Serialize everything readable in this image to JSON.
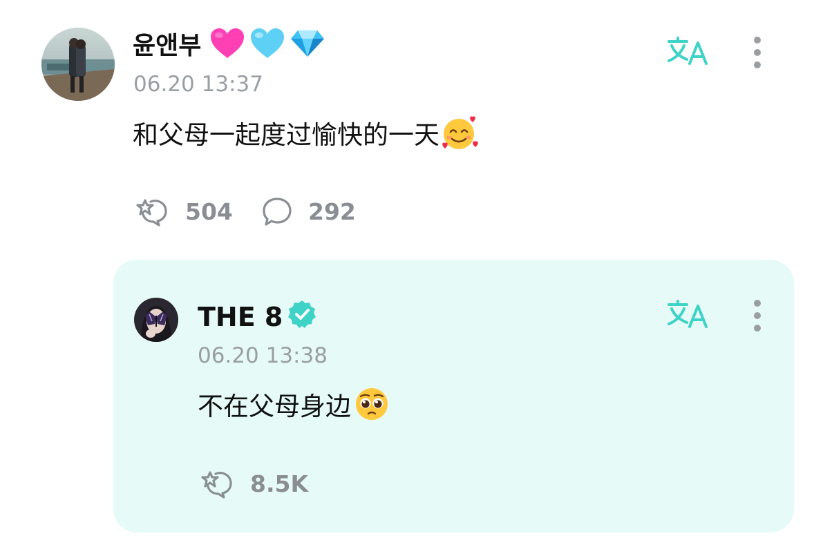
{
  "post": {
    "author_name": "윤앤부",
    "name_emojis": [
      "pink-heart-icon",
      "light-blue-heart-icon",
      "gem-icon"
    ],
    "timestamp": "06.20 13:37",
    "text": "和父母一起度过愉快的一天",
    "text_emoji": "smiling-face-with-hearts-icon",
    "like_count": "504",
    "comment_count": "292"
  },
  "reply": {
    "author_name": "THE 8",
    "verified": true,
    "timestamp": "06.20 13:38",
    "text": "不在父母身边",
    "text_emoji": "pleading-face-icon",
    "like_count": "8.5K"
  },
  "colors": {
    "accent_teal": "#3fd2c6",
    "reply_background": "#e6fbf8",
    "meta_gray": "#9a9ea3",
    "verified_badge": "#3fd2c6",
    "pink_heart": "#ff3fb4",
    "blue_heart": "#5ed0f5"
  }
}
